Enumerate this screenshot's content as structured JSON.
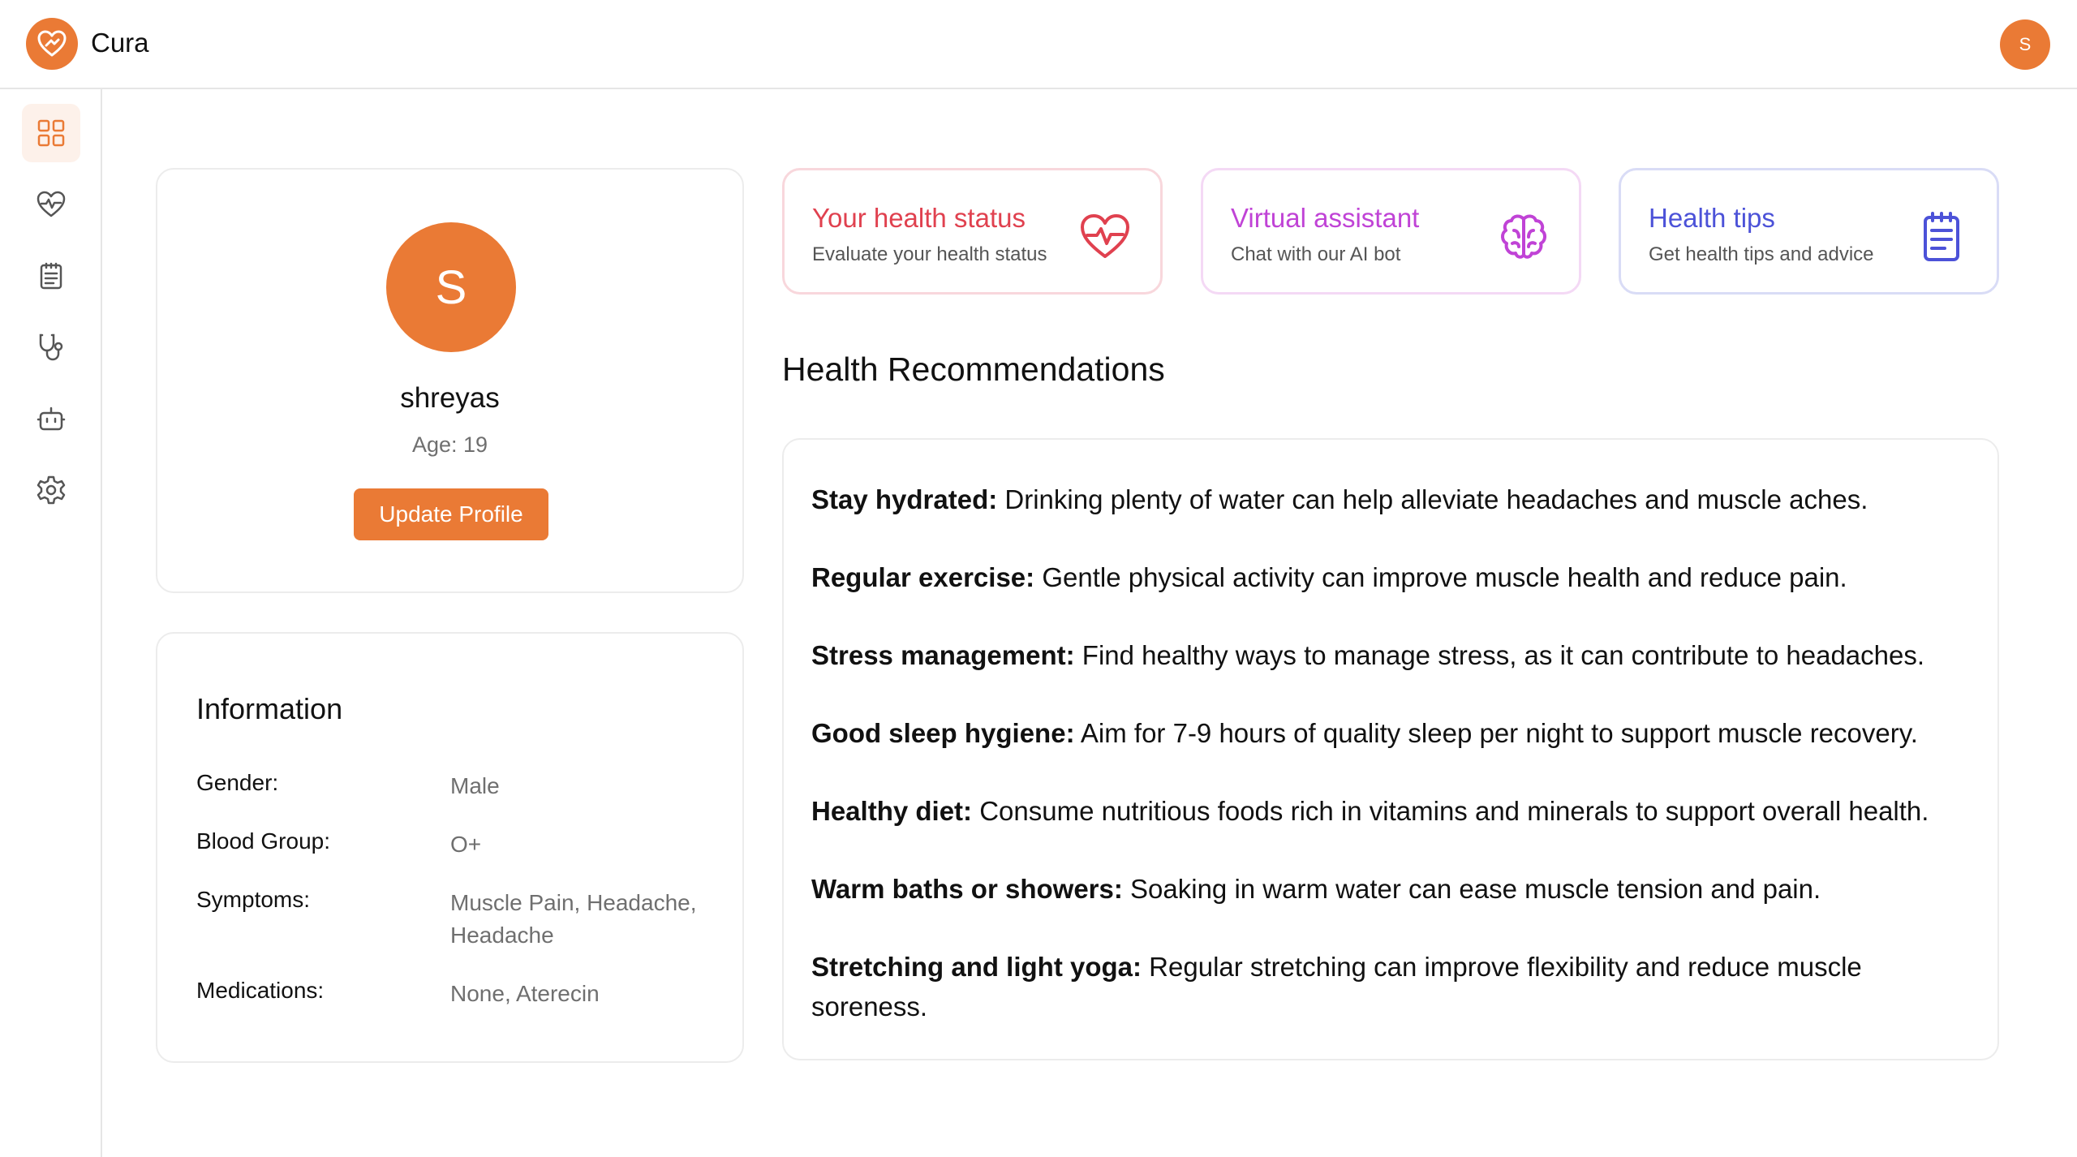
{
  "app": {
    "name": "Cura",
    "user_initial": "S"
  },
  "sidebar": {
    "items": [
      {
        "name": "dashboard",
        "icon": "grid-icon",
        "active": true
      },
      {
        "name": "health-status",
        "icon": "heart-pulse-icon",
        "active": false
      },
      {
        "name": "health-tips",
        "icon": "clipboard-icon",
        "active": false
      },
      {
        "name": "doctors",
        "icon": "stethoscope-icon",
        "active": false
      },
      {
        "name": "assistant",
        "icon": "robot-icon",
        "active": false
      },
      {
        "name": "settings",
        "icon": "gear-icon",
        "active": false
      }
    ]
  },
  "profile": {
    "initial": "S",
    "name": "shreyas",
    "age": "Age: 19",
    "update_label": "Update Profile"
  },
  "information": {
    "title": "Information",
    "rows": [
      {
        "label": "Gender:",
        "value": "Male"
      },
      {
        "label": "Blood Group:",
        "value": "O+"
      },
      {
        "label": "Symptoms:",
        "value": "Muscle Pain, Headache, Headache"
      },
      {
        "label": "Medications:",
        "value": "None, Aterecin"
      }
    ]
  },
  "features": [
    {
      "title": "Your health status",
      "subtitle": "Evaluate your health status",
      "icon": "heart-pulse-icon",
      "color": "#e0414f"
    },
    {
      "title": "Virtual assistant",
      "subtitle": "Chat with our AI bot",
      "icon": "brain-icon",
      "color": "#c043d6"
    },
    {
      "title": "Health tips",
      "subtitle": "Get health tips and advice",
      "icon": "clipboard-icon",
      "color": "#4c52d8"
    }
  ],
  "recommendations": {
    "title": "Health Recommendations",
    "items": [
      {
        "heading": "Stay hydrated:",
        "text": " Drinking plenty of water can help alleviate headaches and muscle aches."
      },
      {
        "heading": "Regular exercise:",
        "text": " Gentle physical activity can improve muscle health and reduce pain."
      },
      {
        "heading": "Stress management:",
        "text": " Find healthy ways to manage stress, as it can contribute to headaches."
      },
      {
        "heading": "Good sleep hygiene:",
        "text": " Aim for 7-9 hours of quality sleep per night to support muscle recovery."
      },
      {
        "heading": "Healthy diet:",
        "text": " Consume nutritious foods rich in vitamins and minerals to support overall health."
      },
      {
        "heading": "Warm baths or showers:",
        "text": " Soaking in warm water can ease muscle tension and pain."
      },
      {
        "heading": "Stretching and light yoga:",
        "text": " Regular stretching can improve flexibility and reduce muscle soreness."
      }
    ]
  },
  "colors": {
    "accent": "#ea7a35"
  }
}
